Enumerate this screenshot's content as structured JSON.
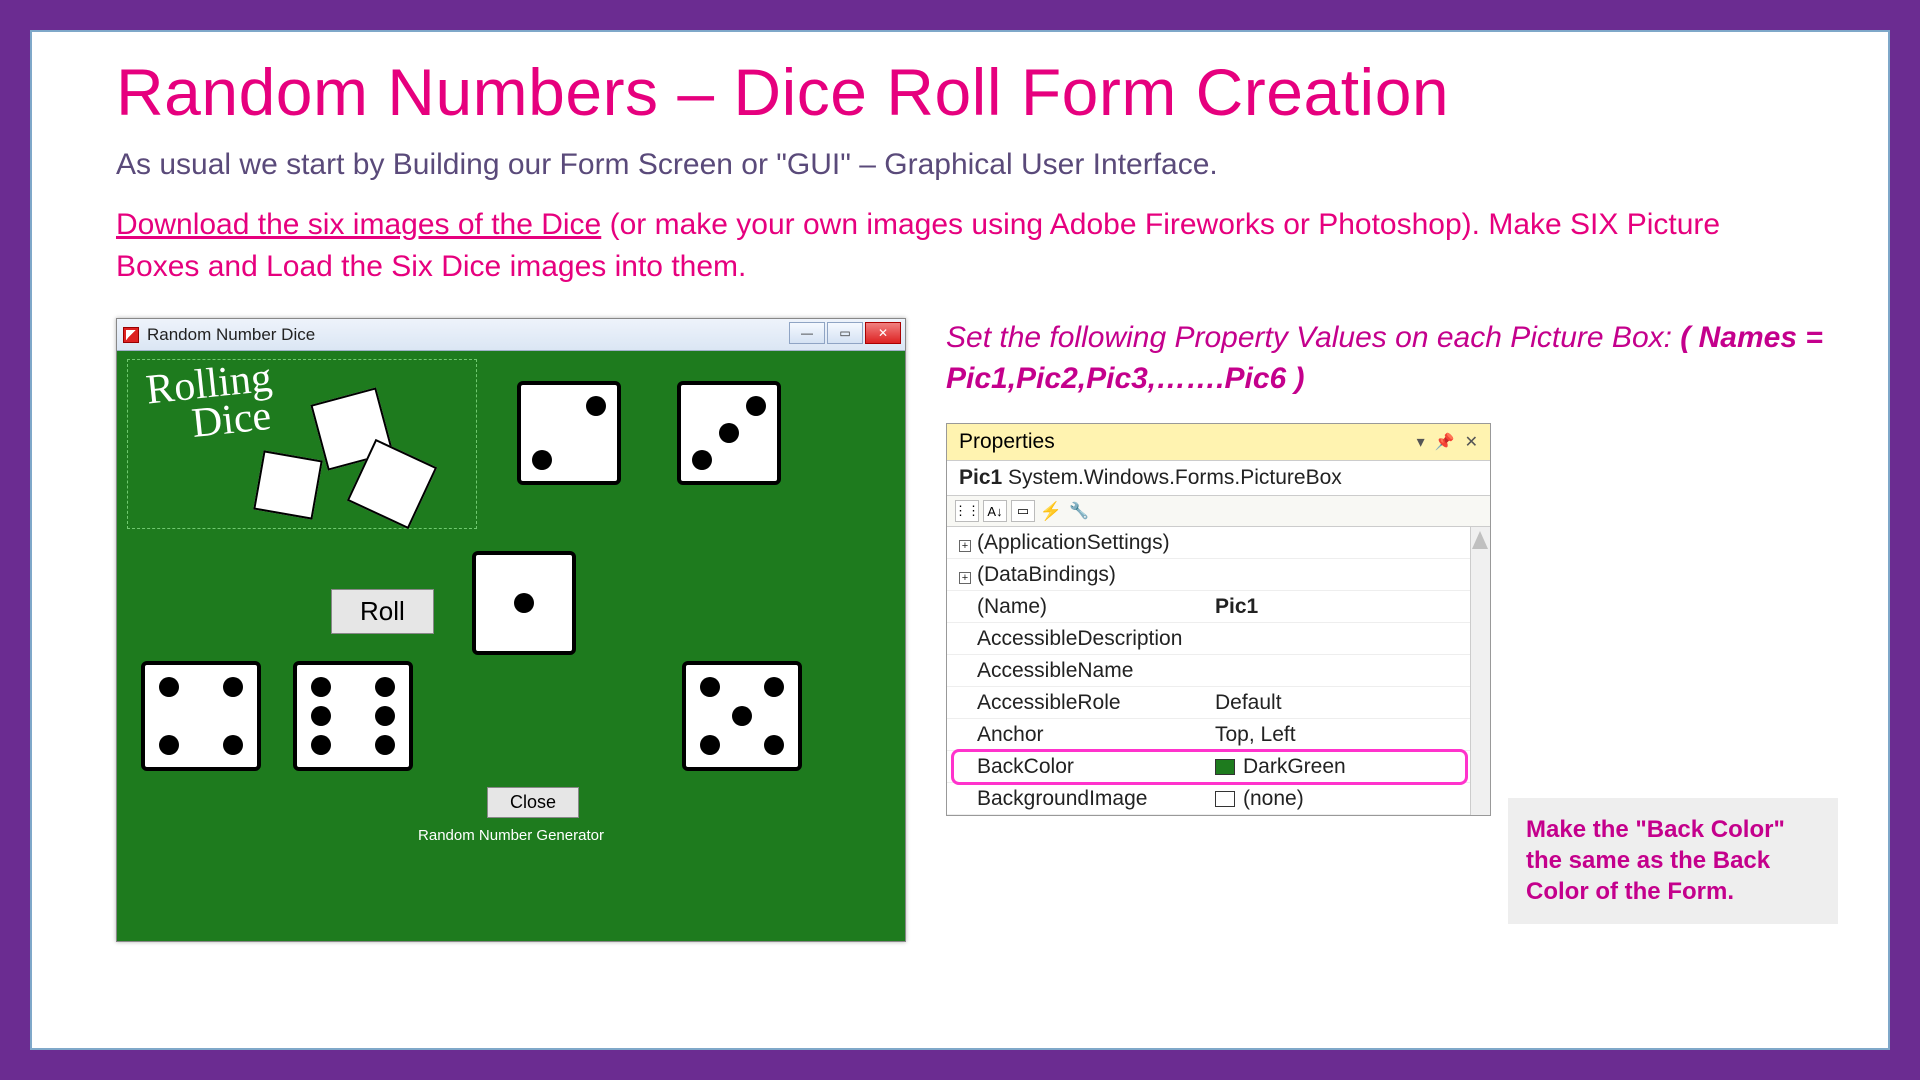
{
  "title": "Random Numbers – Dice Roll Form Creation",
  "intro": "As usual we start by Building our Form Screen or \"GUI\" – Graphical User Interface.",
  "download": {
    "link_text": "Download the six images of the Dice",
    "rest": " (or make your own images using Adobe Fireworks or Photoshop). Make SIX Picture Boxes and Load the Six Dice images into them."
  },
  "winform": {
    "caption": "Random Number Dice",
    "logo_line1": "Rolling",
    "logo_line2": "Dice",
    "roll_label": "Roll",
    "close_label": "Close",
    "footer": "Random Number Generator"
  },
  "instruction": {
    "line": "Set the following Property Values on each Picture Box:  ",
    "bold": "( Names = Pic1,Pic2,Pic3,…….Pic6 )"
  },
  "properties": {
    "header": "Properties",
    "object_name": "Pic1",
    "object_type": "System.Windows.Forms.PictureBox",
    "rows": [
      {
        "name": "(ApplicationSettings)",
        "value": "",
        "group": true
      },
      {
        "name": "(DataBindings)",
        "value": "",
        "group": true
      },
      {
        "name": "(Name)",
        "value": "Pic1",
        "bold": true
      },
      {
        "name": "AccessibleDescription",
        "value": ""
      },
      {
        "name": "AccessibleName",
        "value": ""
      },
      {
        "name": "AccessibleRole",
        "value": "Default"
      },
      {
        "name": "Anchor",
        "value": "Top, Left"
      },
      {
        "name": "BackColor",
        "value": "DarkGreen",
        "swatch": "green",
        "highlight": true
      },
      {
        "name": "BackgroundImage",
        "value": "(none)",
        "swatch": "none"
      }
    ]
  },
  "note": "Make the \"Back Color\" the same as the Back Color of the Form."
}
